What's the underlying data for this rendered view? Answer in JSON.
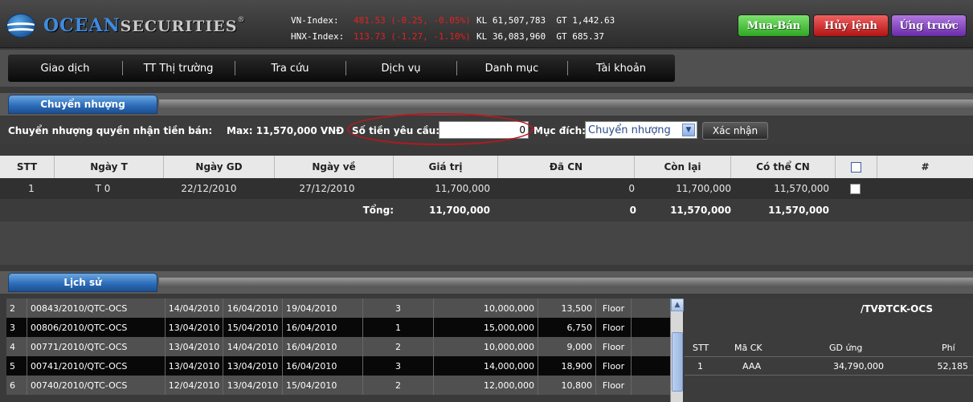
{
  "header": {
    "logo_text_ocean": "OCEAN",
    "logo_text_securities": "SECURITIES",
    "logo_reg": "®",
    "vn_index_label": "VN-Index:",
    "vn_index_value": "481.53 (-0.25, -0.05%)",
    "hnx_index_label": "HNX-Index:",
    "hnx_index_value": "113.73 (-1.27, -1.10%)",
    "vn_vol": "KL 61,507,783",
    "vn_val": "GT 1,442.63",
    "hnx_vol": "KL 36,083,960",
    "hnx_val": "GT 685.37",
    "buy_sell_label": "Mua-Bán",
    "cancel_label": "Hủy lệnh",
    "advance_label": "Ứng trước",
    "colors": {
      "buy": "#2ea823",
      "cancel": "#b31414",
      "advance": "#6a2aa8",
      "index_down": "#e62020"
    }
  },
  "menu": {
    "items": [
      {
        "label": "Giao dịch"
      },
      {
        "label": "TT Thị trường"
      },
      {
        "label": "Tra cứu"
      },
      {
        "label": "Dịch vụ"
      },
      {
        "label": "Danh mục"
      },
      {
        "label": "Tài khoản"
      }
    ]
  },
  "transfer": {
    "tab_label": "Chuyển nhượng",
    "right_label": "Chuyển nhượng quyền nhận tiền bán:",
    "max_label": "Max: 11,570,000 VNĐ",
    "amount_label": "Số tiền yêu cầu:",
    "amount_value": "0",
    "purpose_label": "Mục đích:",
    "purpose_selected": "Chuyển nhượng",
    "confirm_label": "Xác nhận",
    "columns": [
      "STT",
      "Ngày T",
      "Ngày GD",
      "Ngày về",
      "Giá trị",
      "Đã CN",
      "Còn lại",
      "Có thể CN",
      "#"
    ],
    "rows": [
      {
        "stt": "1",
        "ngay_t": "T 0",
        "ngay_gd": "22/12/2010",
        "ngay_ve": "27/12/2010",
        "gia_tri": "11,700,000",
        "da_cn": "0",
        "con_lai": "11,700,000",
        "co_the_cn": "11,570,000"
      }
    ],
    "total": {
      "label": "Tổng:",
      "gia_tri": "11,700,000",
      "da_cn": "0",
      "con_lai": "11,570,000",
      "co_the_cn": "11,570,000"
    }
  },
  "history": {
    "tab_label": "Lịch sử",
    "rows": [
      {
        "stt": "2",
        "code": "00843/2010/QTC-OCS",
        "d1": "14/04/2010",
        "d2": "16/04/2010",
        "d3": "19/04/2010",
        "n": "3",
        "amount": "10,000,000",
        "fee": "13,500",
        "type": "Floor"
      },
      {
        "stt": "3",
        "code": "00806/2010/QTC-OCS",
        "d1": "13/04/2010",
        "d2": "15/04/2010",
        "d3": "16/04/2010",
        "n": "1",
        "amount": "15,000,000",
        "fee": "6,750",
        "type": "Floor"
      },
      {
        "stt": "4",
        "code": "00771/2010/QTC-OCS",
        "d1": "13/04/2010",
        "d2": "14/04/2010",
        "d3": "16/04/2010",
        "n": "2",
        "amount": "10,000,000",
        "fee": "9,000",
        "type": "Floor"
      },
      {
        "stt": "5",
        "code": "00741/2010/QTC-OCS",
        "d1": "13/04/2010",
        "d2": "13/04/2010",
        "d3": "16/04/2010",
        "n": "3",
        "amount": "14,000,000",
        "fee": "18,900",
        "type": "Floor"
      },
      {
        "stt": "6",
        "code": "00740/2010/QTC-OCS",
        "d1": "12/04/2010",
        "d2": "13/04/2010",
        "d3": "15/04/2010",
        "n": "2",
        "amount": "12,000,000",
        "fee": "10,800",
        "type": "Floor"
      }
    ]
  },
  "detail": {
    "title": "/TVĐTCK-OCS",
    "columns": [
      "STT",
      "Mã CK",
      "GD ứng",
      "Phí"
    ],
    "rows": [
      {
        "stt": "1",
        "ma_ck": "AAA",
        "gd_ung": "34,790,000",
        "phi": "52,185"
      }
    ]
  }
}
